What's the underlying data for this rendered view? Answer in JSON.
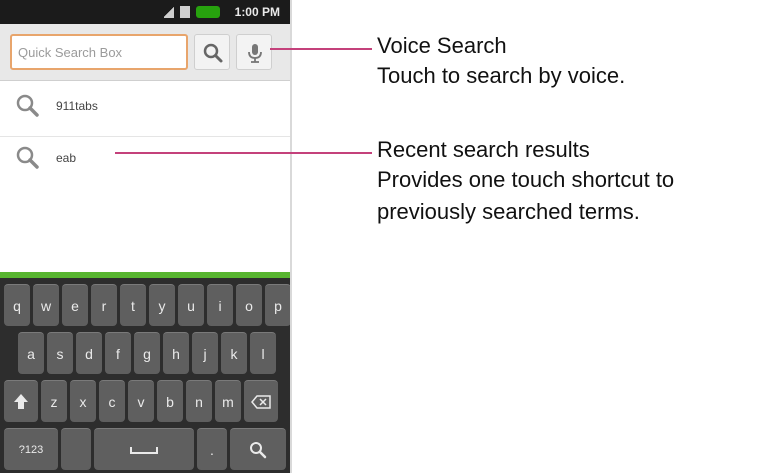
{
  "status_bar": {
    "time": "1:00 PM"
  },
  "search": {
    "placeholder": "Quick Search Box"
  },
  "results": [
    {
      "label": "911tabs"
    },
    {
      "label": "eab"
    }
  ],
  "keyboard": {
    "row1": [
      "q",
      "w",
      "e",
      "r",
      "t",
      "y",
      "u",
      "i",
      "o",
      "p"
    ],
    "row2": [
      "a",
      "s",
      "d",
      "f",
      "g",
      "h",
      "j",
      "k",
      "l"
    ],
    "row3": [
      "z",
      "x",
      "c",
      "v",
      "b",
      "n",
      "m"
    ],
    "row4_mode": "?123",
    "row4_dot": "."
  },
  "callouts": {
    "voice_title": "Voice Search",
    "voice_desc": "Touch to search by voice.",
    "recent_title": "Recent search results",
    "recent_desc_1": "Provides one touch shortcut to",
    "recent_desc_2": "previously searched terms."
  },
  "colors": {
    "accent_line": "#c4417b",
    "search_border": "#e8a56c",
    "battery": "#27a20e"
  }
}
